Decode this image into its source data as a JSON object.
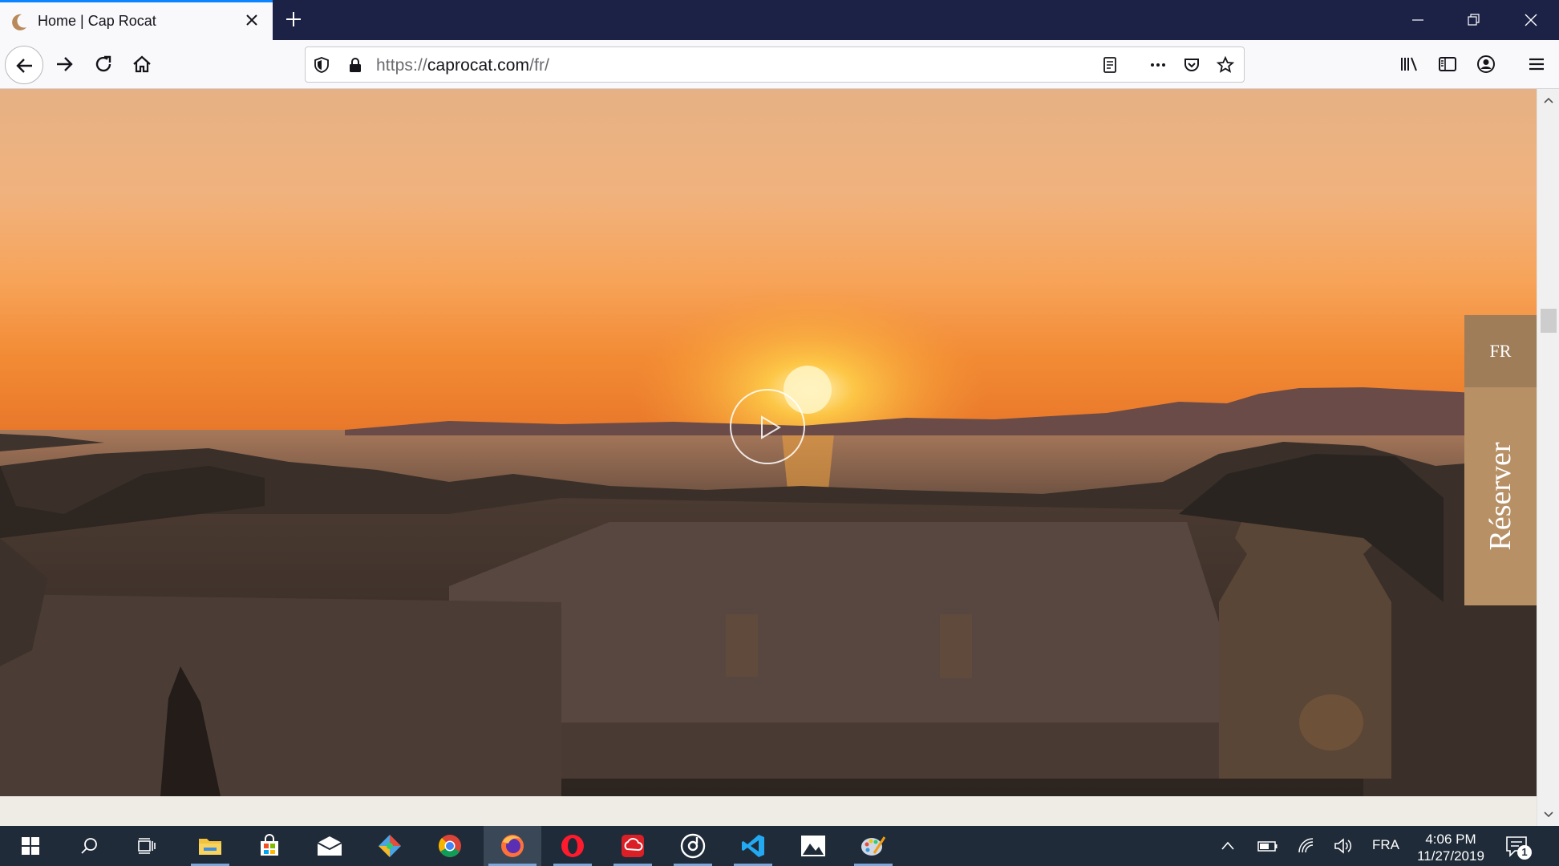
{
  "browser": {
    "tab_title": "Home | Cap Rocat",
    "url": "https://caprocat.com/fr/",
    "url_prefix": "https://",
    "url_domain": "caprocat.com",
    "url_path": "/fr/"
  },
  "page": {
    "language_label": "FR",
    "reserve_label": "Réserver"
  },
  "taskbar": {
    "apps": [
      "windows-start",
      "search",
      "task-view",
      "file-explorer",
      "microsoft-store",
      "mail",
      "git-app",
      "chrome",
      "firefox",
      "opera",
      "creative-cloud",
      "media-player",
      "vscode",
      "photos",
      "paint"
    ],
    "input_language": "FRA",
    "time": "4:06 PM",
    "date": "11/27/2019",
    "notification_count": "1"
  },
  "colors": {
    "accent_tab": "#0a84ff",
    "lang_button": "#9f7d59",
    "reserve_button": "#b79066",
    "titlebar": "#1c2146"
  }
}
